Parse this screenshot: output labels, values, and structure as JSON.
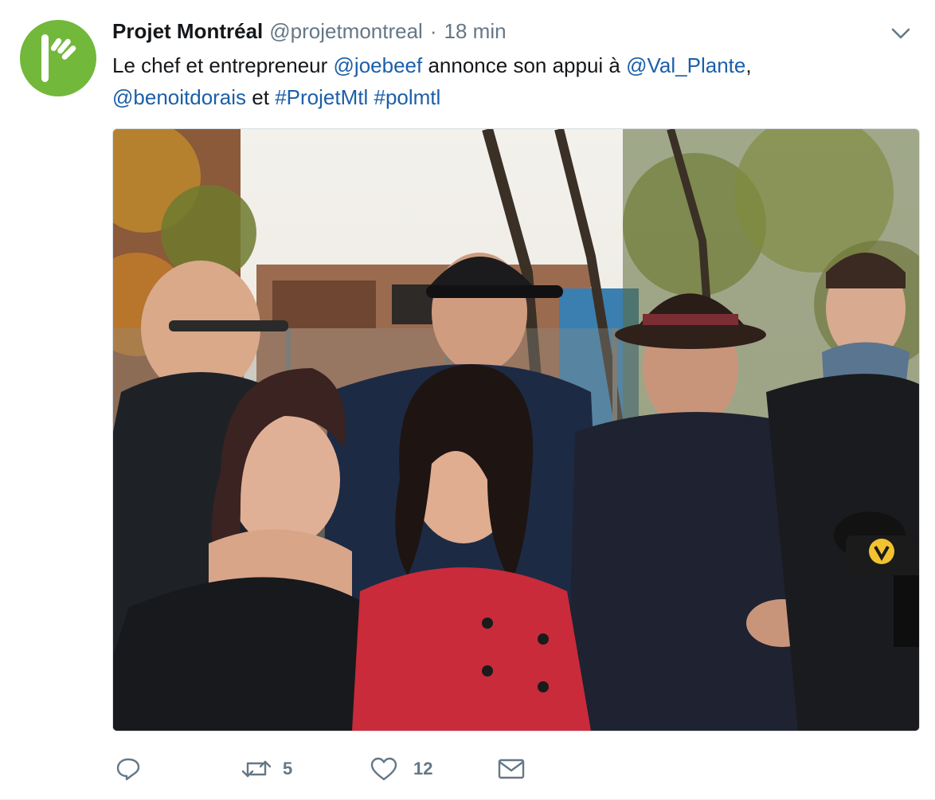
{
  "tweet": {
    "display_name": "Projet Montréal",
    "handle": "@projetmontreal",
    "separator": "·",
    "time": "18 min",
    "text": {
      "line1_prefix": "Le chef et entrepreneur ",
      "mention_joebeef": "@joebeef",
      "line1_middle": " annonce son appui à ",
      "mention_valplante": "@Val_Plante",
      "line1_suffix": ",",
      "mention_benoitdorais": "@benoitdorais",
      "line2_middle": " et ",
      "hashtag_projetmtl": "#ProjetMtl",
      "line2_space": " ",
      "hashtag_polmtl": "#polmtl"
    },
    "actions": {
      "reply_icon": "reply-icon",
      "retweet_icon": "retweet-icon",
      "retweet_count": "5",
      "like_icon": "heart-icon",
      "like_count": "12",
      "dm_icon": "envelope-icon"
    }
  },
  "colors": {
    "link": "#1b5fa8",
    "muted": "#657786",
    "avatar_bg": "#72b83b",
    "text": "#14171a"
  }
}
